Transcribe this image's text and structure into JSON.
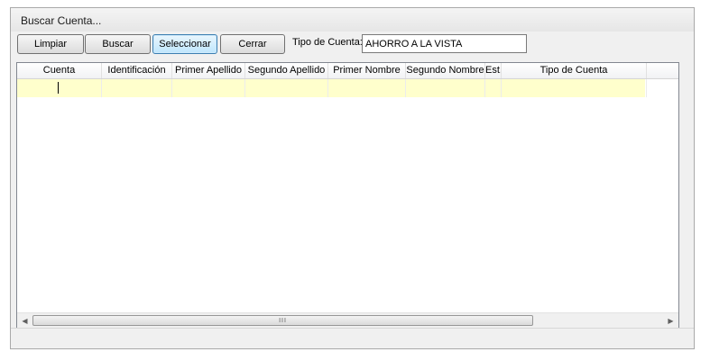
{
  "window": {
    "title": "Buscar Cuenta..."
  },
  "toolbar": {
    "limpiar_label": "Limpiar",
    "buscar_label": "Buscar",
    "seleccionar_label": "Seleccionar",
    "cerrar_label": "Cerrar"
  },
  "tipo_cuenta": {
    "label": "Tipo de Cuenta:",
    "value": "AHORRO A LA VISTA"
  },
  "grid": {
    "columns": [
      "Cuenta",
      "Identificación",
      "Primer Apellido",
      "Segundo Apellido",
      "Primer Nombre",
      "Segundo Nombre",
      "Est.",
      "Tipo de Cuenta"
    ],
    "row_highlight_color": "#ffffcc"
  },
  "scrollbar": {
    "left_arrow": "◀",
    "right_arrow": "▶",
    "grip": "III"
  }
}
